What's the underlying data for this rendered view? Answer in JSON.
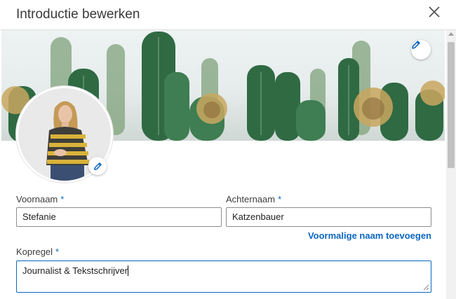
{
  "dialog": {
    "title": "Introductie bewerken"
  },
  "form": {
    "first_name": {
      "label": "Voornaam",
      "required_mark": "*",
      "value": "Stefanie"
    },
    "last_name": {
      "label": "Achternaam",
      "required_mark": "*",
      "value": "Katzenbauer"
    },
    "add_former_name_link": "Voormalige naam toevoegen",
    "headline": {
      "label": "Kopregel",
      "required_mark": "*",
      "value": "Journalist & Tekstschrijver"
    }
  },
  "icons": {
    "close": "close-icon",
    "banner_edit": "pencil-icon",
    "photo_edit": "pencil-icon"
  },
  "colors": {
    "accent": "#0a66c2",
    "focus_border": "#0a66c2",
    "input_border": "#8c8c8c"
  }
}
